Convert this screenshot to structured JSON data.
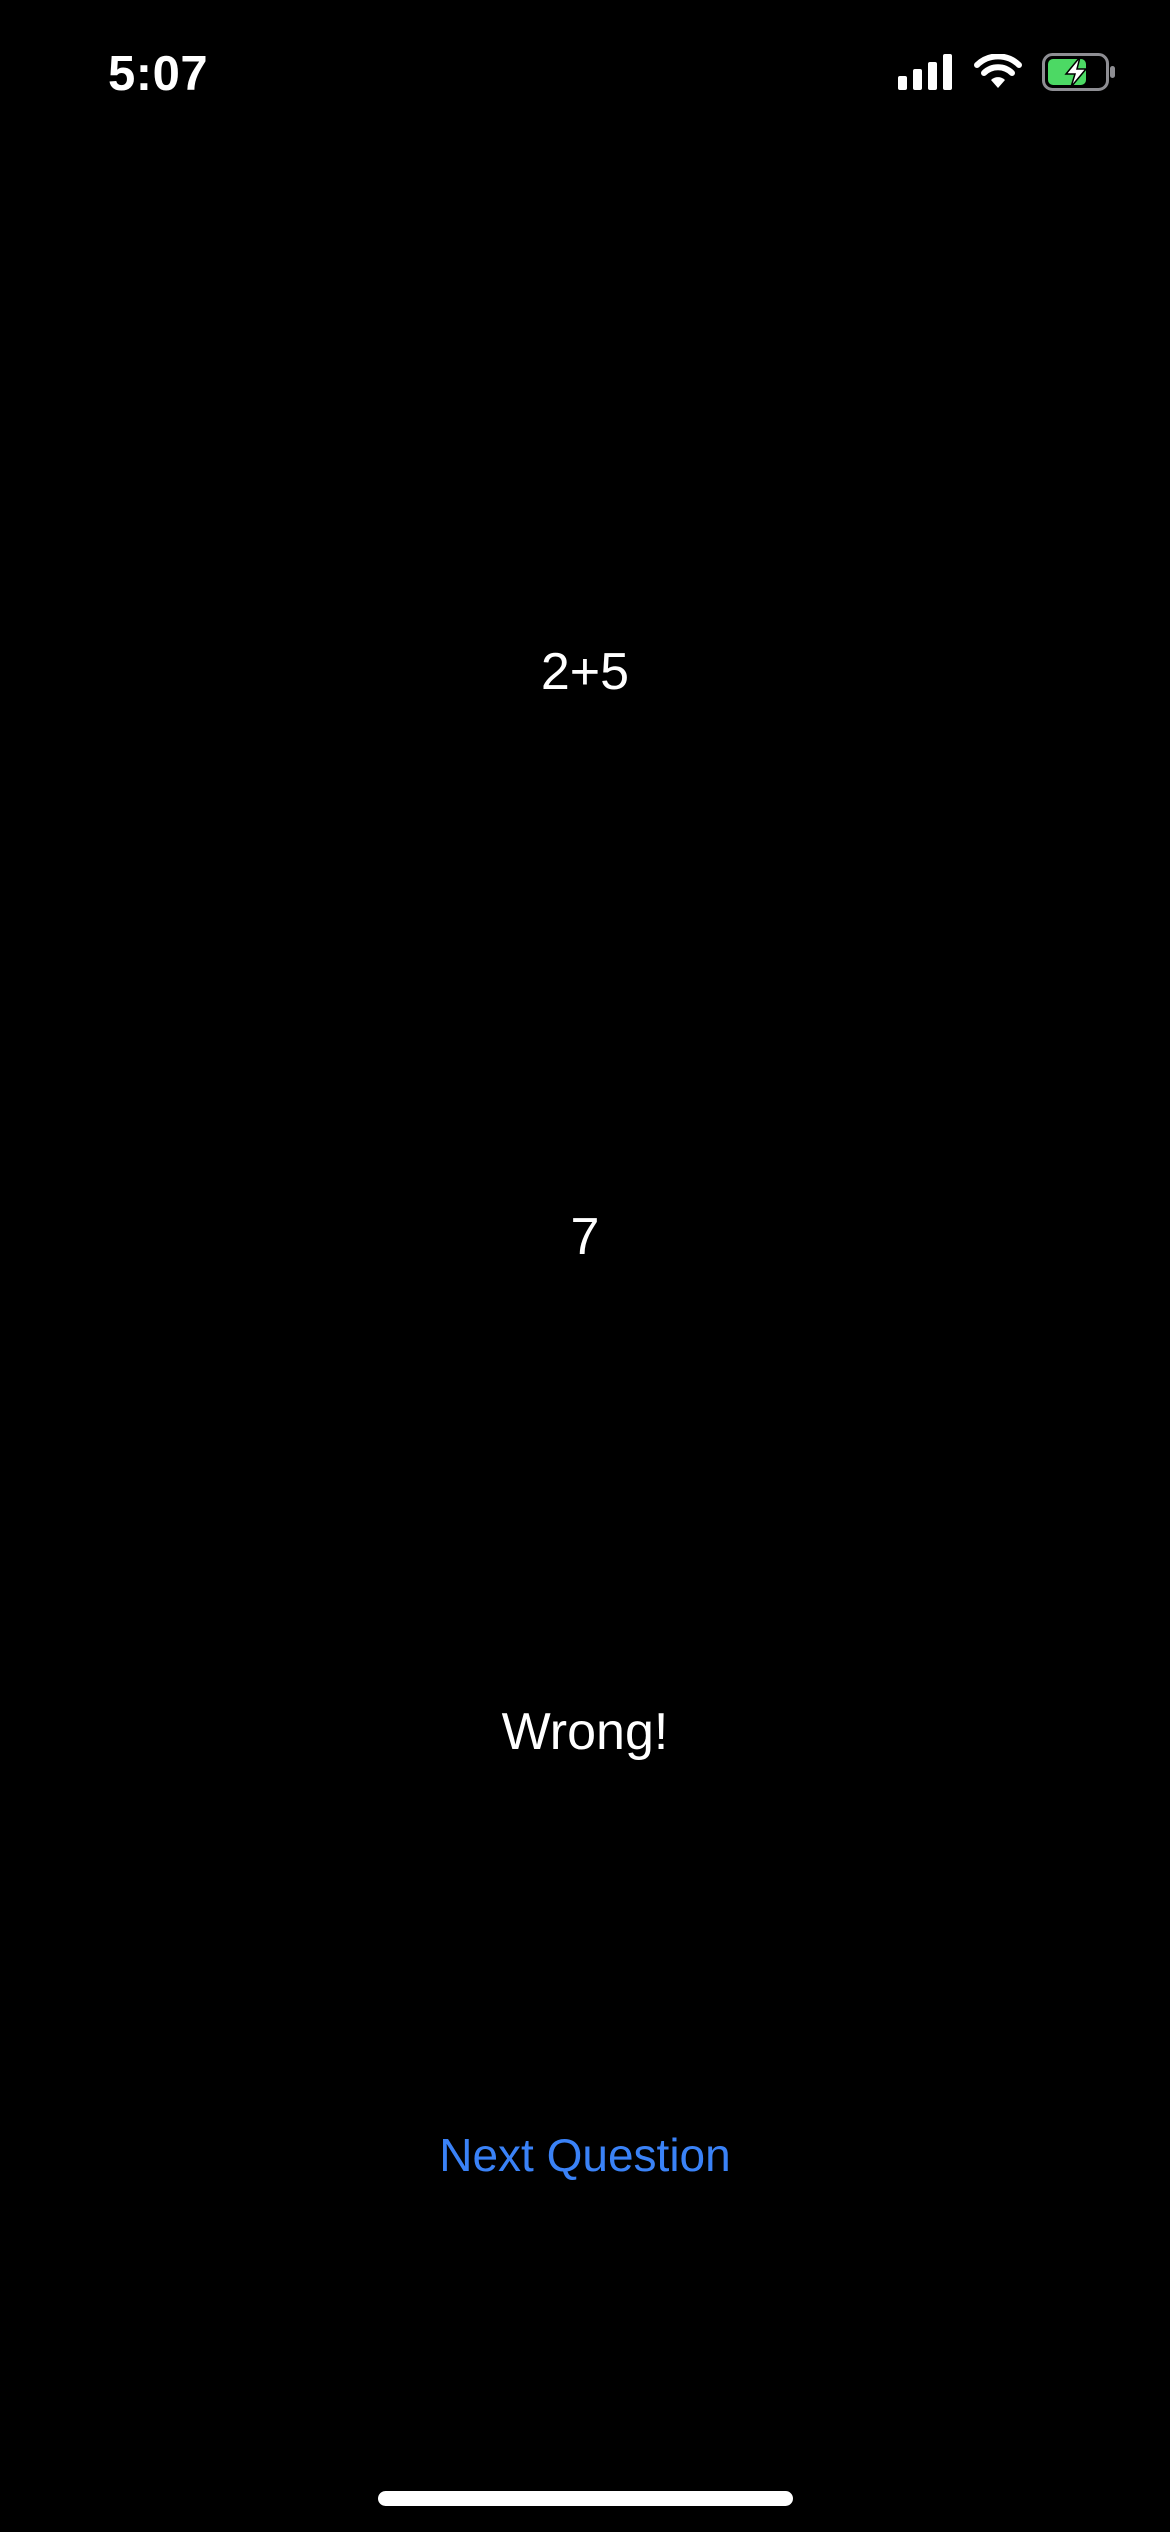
{
  "status_bar": {
    "time": "5:07",
    "icons": [
      "cellular-signal-icon",
      "wifi-icon",
      "battery-charging-icon"
    ],
    "battery_color": "#4cd964"
  },
  "quiz": {
    "question": "2+5",
    "answer": "7",
    "result": "Wrong!"
  },
  "actions": {
    "next_question_label": "Next Question",
    "link_color": "#3a82f7"
  }
}
